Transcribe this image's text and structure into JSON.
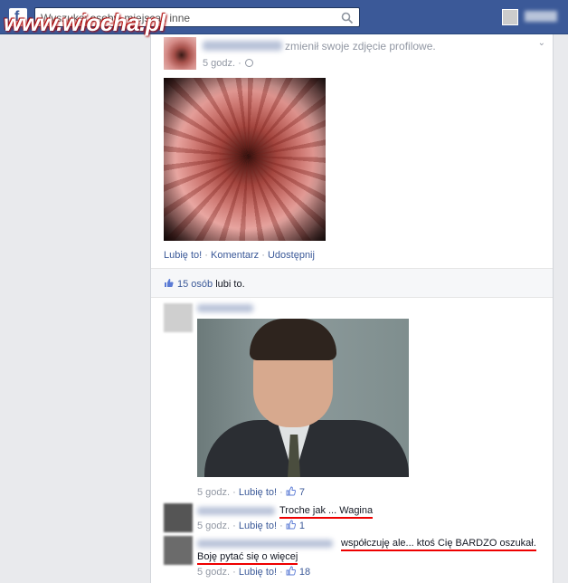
{
  "topbar": {
    "logo": "f",
    "search_placeholder": "Wyszukaj osoby, miejsca i inne",
    "watermark": "www.wiocha.pl"
  },
  "post": {
    "action_text": "zmienił swoje zdjęcie profilowe.",
    "time": "5 godz. ·",
    "actions": {
      "like": "Lubię to!",
      "sep1": " · ",
      "comment": "Komentarz",
      "sep2": " · ",
      "share": "Udostępnij"
    },
    "likes": {
      "count_text": "15 osób",
      "suffix": " lubi to."
    }
  },
  "comments": [
    {
      "time": "5 godz. · ",
      "like_label": "Lubię to!",
      "likes": "7"
    },
    {
      "text": "Troche jak ... Wagina",
      "time": "5 godz. · ",
      "like_label": "Lubię to!",
      "likes": "1"
    },
    {
      "text_line1": "współczuję ale... ktoś Cię BARDZO oszukał.",
      "text_line2": "Boję pytać się o więcej",
      "time": "5 godz. · ",
      "like_label": "Lubię to!",
      "likes": "18"
    }
  ],
  "colors": {
    "brand": "#3b5998",
    "highlight": "#e00000"
  }
}
